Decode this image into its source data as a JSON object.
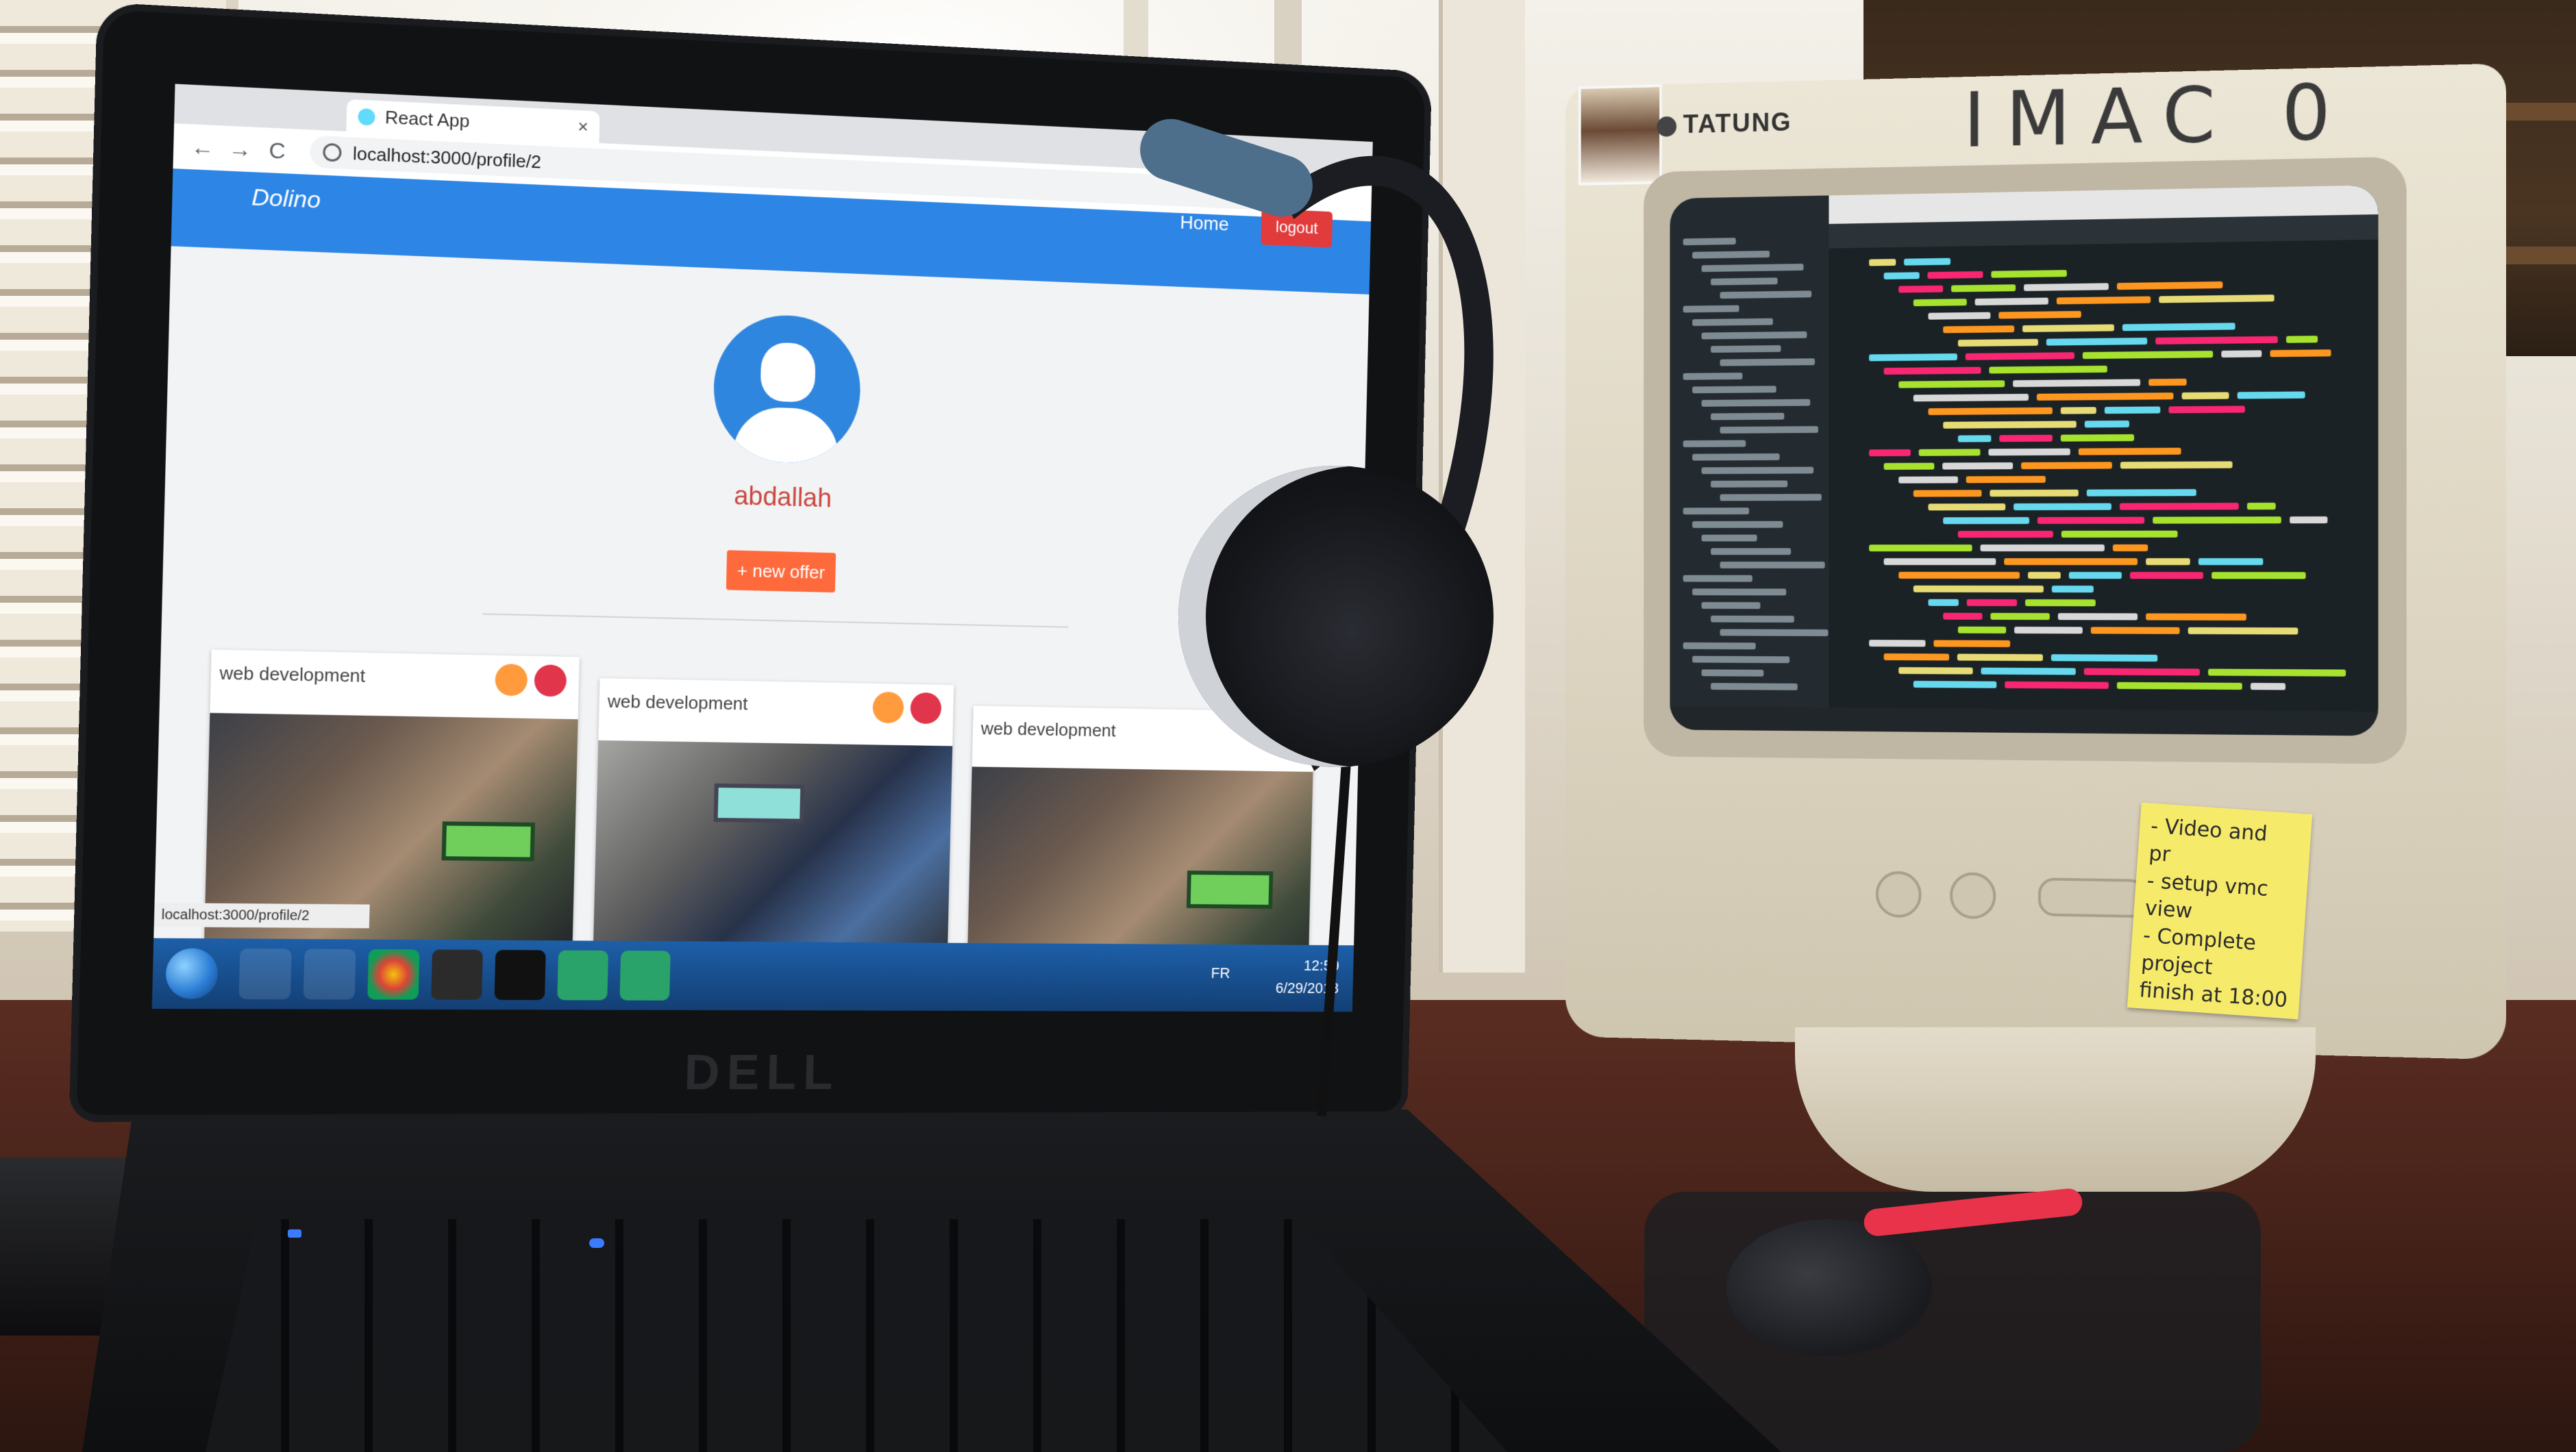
{
  "browser": {
    "tab_title": "React App",
    "tab_close": "×",
    "url": "localhost:3000/profile/2",
    "back": "←",
    "forward": "→",
    "reload": "C",
    "star": "☆"
  },
  "app": {
    "brand": "Dolino",
    "nav_home": "Home",
    "nav_logout": "logout",
    "profile_name": "abdallah",
    "new_offer_label": "+ new offer",
    "offers": [
      {
        "title": "web development"
      },
      {
        "title": "web development"
      },
      {
        "title": "web development"
      }
    ],
    "status_url": "localhost:3000/profile/2"
  },
  "taskbar": {
    "lang": "FR",
    "clock_time": "12:59",
    "clock_date": "6/29/2018"
  },
  "laptop": {
    "brand": "DELL"
  },
  "monitor": {
    "brand": "TATUNG",
    "handwritten_label": "IMAC 0"
  },
  "sticky_note": {
    "lines": [
      "- Video and",
      "pr",
      "- setup vmc",
      "view",
      "- Complete project",
      "finish at 18:00"
    ]
  },
  "colors": {
    "navbar": "#2d86e6",
    "logout": "#e23b3b",
    "new_offer": "#ff6a3d",
    "profile_name": "#c9463d",
    "avatar": "#2f86de",
    "sticky": "#f6ea6b"
  },
  "icons": {
    "card_user": "user-icon",
    "card_delete": "trash-icon",
    "avatar": "person-icon"
  }
}
